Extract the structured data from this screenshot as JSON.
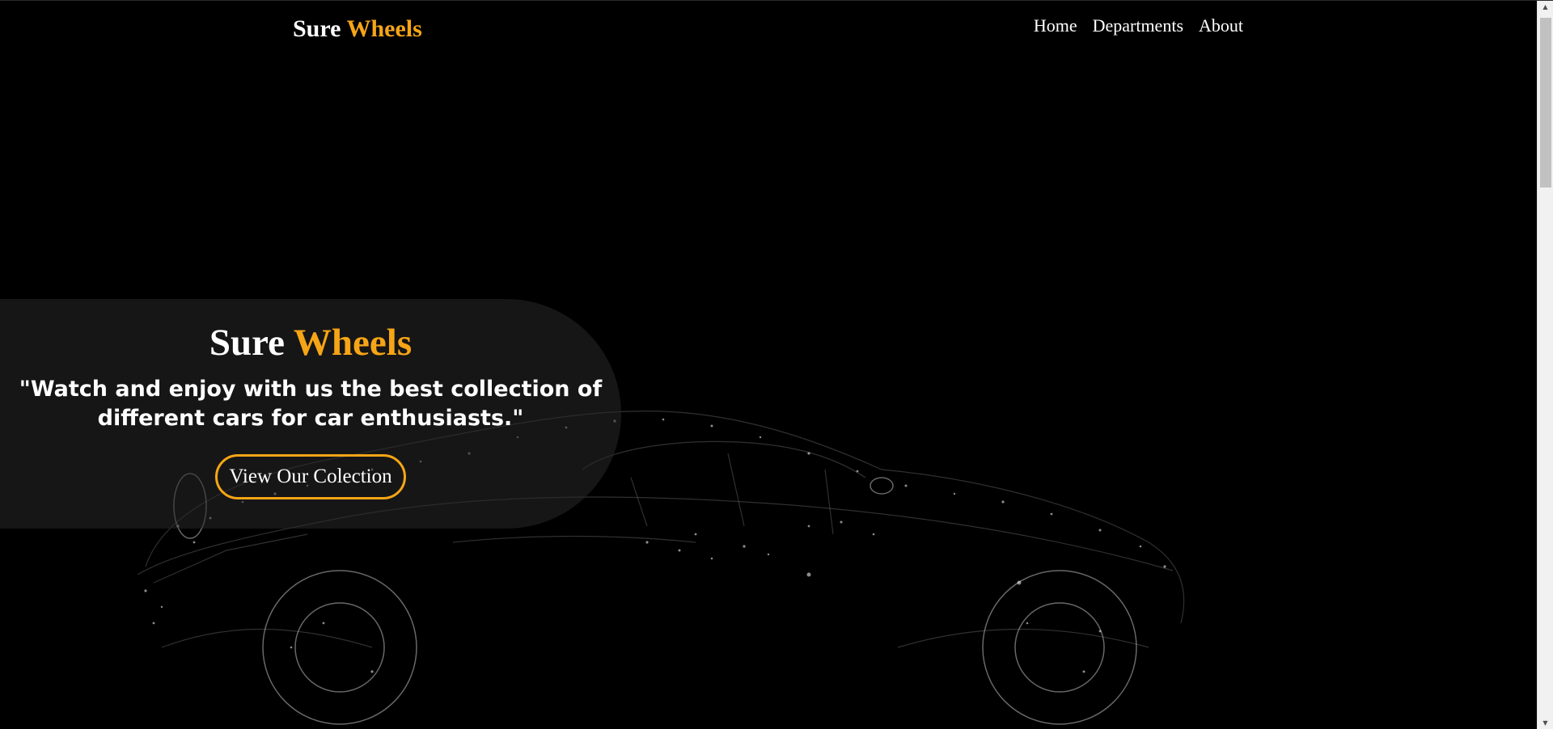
{
  "header": {
    "brand_first": "Sure",
    "brand_second": "Wheels",
    "nav": [
      "Home",
      "Departments",
      "About"
    ]
  },
  "hero": {
    "title_first": "Sure",
    "title_second": "Wheels",
    "tagline": "\"Watch and enjoy with us the best collection of different cars for car enthusiasts.\"",
    "cta_label": "View Our Colection"
  },
  "colors": {
    "background": "#000000",
    "accent": "#f5a516",
    "text": "#ffffff"
  },
  "icons": {
    "scroll_up": "scroll-up-arrow-icon",
    "scroll_down": "scroll-down-arrow-icon",
    "background_art": "car-wireframe-icon"
  }
}
